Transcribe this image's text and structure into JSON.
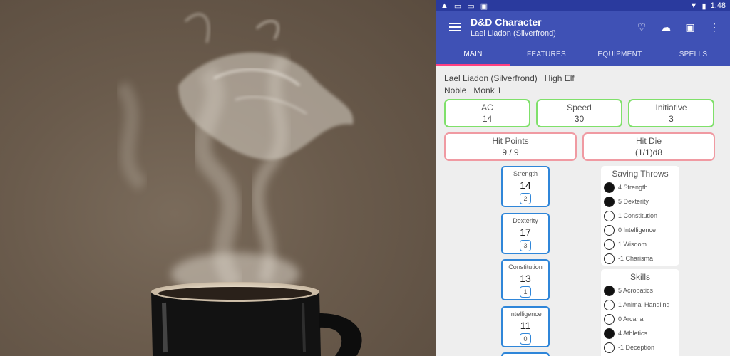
{
  "status": {
    "time": "1:48"
  },
  "appbar": {
    "title": "D&D Character",
    "subtitle": "Lael Liadon (Silverfrond)"
  },
  "tabs": [
    "MAIN",
    "FEATURES",
    "EQUIPMENT",
    "SPELLS"
  ],
  "character": {
    "name": "Lael Liadon (Silverfrond)",
    "race": "High Elf",
    "background": "Noble",
    "class": "Monk 1"
  },
  "stats": {
    "ac": {
      "label": "AC",
      "value": "14"
    },
    "speed": {
      "label": "Speed",
      "value": "30"
    },
    "initiative": {
      "label": "Initiative",
      "value": "3"
    },
    "hp": {
      "label": "Hit Points",
      "value": "9 / 9"
    },
    "hitdie": {
      "label": "Hit Die",
      "value": "(1/1)d8"
    }
  },
  "abilities": [
    {
      "name": "Strength",
      "score": "14",
      "mod": "2"
    },
    {
      "name": "Dexterity",
      "score": "17",
      "mod": "3"
    },
    {
      "name": "Constitution",
      "score": "13",
      "mod": "1"
    },
    {
      "name": "Intelligence",
      "score": "11",
      "mod": "0"
    }
  ],
  "saving_throws": {
    "title": "Saving Throws",
    "items": [
      {
        "label": "4 Strength",
        "proficient": true
      },
      {
        "label": "5 Dexterity",
        "proficient": true
      },
      {
        "label": "1 Constitution",
        "proficient": false
      },
      {
        "label": "0 Intelligence",
        "proficient": false
      },
      {
        "label": "1 Wisdom",
        "proficient": false
      },
      {
        "label": "-1 Charisma",
        "proficient": false
      }
    ]
  },
  "skills": {
    "title": "Skills",
    "items": [
      {
        "label": "5 Acrobatics",
        "proficient": true
      },
      {
        "label": "1 Animal Handling",
        "proficient": false
      },
      {
        "label": "0 Arcana",
        "proficient": false
      },
      {
        "label": "4 Athletics",
        "proficient": true
      },
      {
        "label": "-1 Deception",
        "proficient": false
      }
    ]
  },
  "icons": {
    "accent": "#3f51b5",
    "tab_indicator": "#ff4081"
  }
}
